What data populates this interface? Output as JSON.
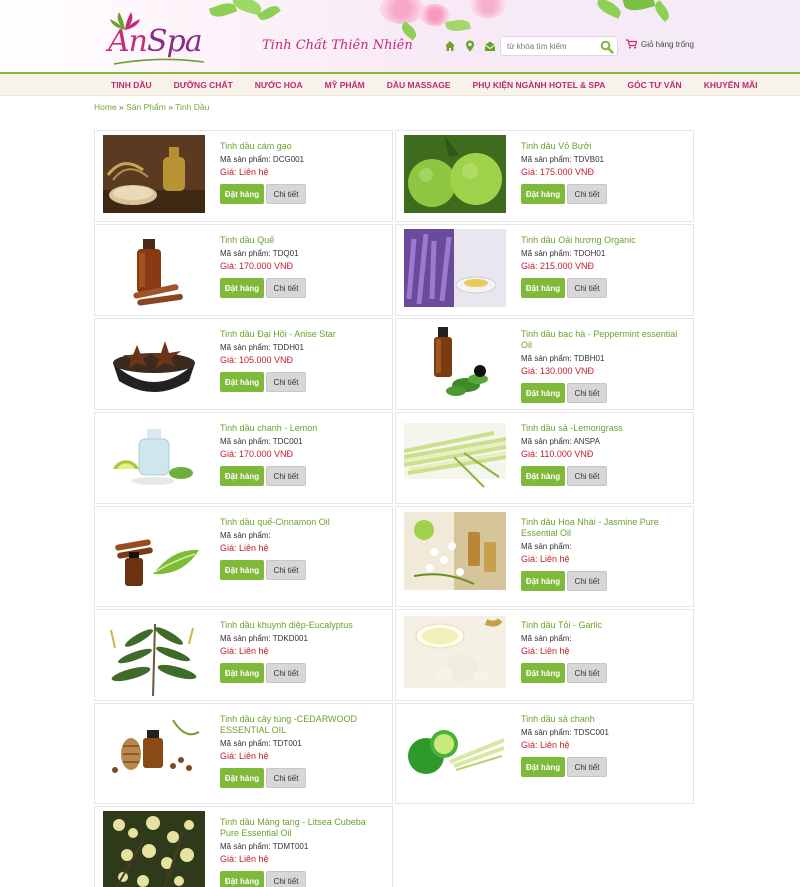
{
  "header": {
    "logo_text_a": "An",
    "logo_text_b": "Spa",
    "tagline": "Tinh Chất Thiên Nhiên",
    "search_placeholder": "từ khóa tìm kiếm",
    "cart_label": "Giỏ hàng trống"
  },
  "nav": [
    "TINH DẦU",
    "DƯỠNG CHẤT",
    "NƯỚC HOA",
    "MỸ PHẨM",
    "DẦU MASSAGE",
    "PHỤ KIỆN NGÀNH HOTEL & SPA",
    "GÓC TƯ VẤN",
    "KHUYẾN MÃI"
  ],
  "breadcrumb": {
    "home": "Home",
    "sep": " » ",
    "products": "Sản Phẩm",
    "current": "Tinh Dầu"
  },
  "buttons": {
    "order": "Đặt hàng",
    "detail": "Chi tiết"
  },
  "products": [
    {
      "name": "Tinh dầu cám gạo",
      "sku": "Mã sản phẩm: DCG001",
      "price": "Giá: Liên hệ",
      "image": "rice-bran-oil"
    },
    {
      "name": "Tinh dầu Vỏ Bưởi",
      "sku": "Mã sản phẩm: TDVB01",
      "price": "Giá: 175.000 VNĐ",
      "image": "pomelo"
    },
    {
      "name": "Tinh dầu Quế",
      "sku": "Mã sản phẩm: TDQ01",
      "price": "Giá: 170.000 VNĐ",
      "image": "cinnamon-bottle"
    },
    {
      "name": "Tinh dầu Oải hương Organic",
      "sku": "Mã sản phẩm: TDOH01",
      "price": "Giá: 215.000 VNĐ",
      "image": "lavender"
    },
    {
      "name": "Tinh dầu Đại Hồi - Anise Star",
      "sku": "Mã sản phẩm: TDDH01",
      "price": "Giá: 105.000 VNĐ",
      "image": "star-anise"
    },
    {
      "name": "Tinh dầu bạc hà - Peppermint essential Oil",
      "sku": "Mã sản phẩm: TDBH01",
      "price": "Giá: 130.000 VNĐ",
      "image": "peppermint"
    },
    {
      "name": "Tinh dầu chanh - Lemon",
      "sku": "Mã sản phẩm: TDC001",
      "price": "Giá: 170.000 VNĐ",
      "image": "lemon"
    },
    {
      "name": "Tinh dầu sả -Lemongrass",
      "sku": "Mã sản phẩm: ANSPA",
      "price": "Giá: 110.000 VNĐ",
      "image": "lemongrass"
    },
    {
      "name": "Tinh dầu quế-Cinnamon Oil",
      "sku": "Mã sản phẩm:",
      "price": "Giá: Liên hệ",
      "image": "cinnamon-oil"
    },
    {
      "name": "Tinh dầu Hoa Nhài - Jasmine Pure Essential Oil",
      "sku": "Mã sản phẩm:",
      "price": "Giá: Liên hệ",
      "image": "jasmine"
    },
    {
      "name": "Tinh dầu khuynh diệp-Eucalyptus",
      "sku": "Mã sản phẩm: TDKD001",
      "price": "Giá: Liên hệ",
      "image": "eucalyptus"
    },
    {
      "name": "Tinh dầu Tỏi - Garlic",
      "sku": "Mã sản phẩm:",
      "price": "Giá: Liên hệ",
      "image": "garlic"
    },
    {
      "name": "Tinh dầu cây tùng -CEDARWOOD ESSENTIAL OIL",
      "sku": "Mã sản phẩm: TDT001",
      "price": "Giá: Liên hệ",
      "image": "cedarwood"
    },
    {
      "name": "Tinh dầu sả chanh",
      "sku": "Mã sản phẩm: TDSC001",
      "price": "Giá: Liên hệ",
      "image": "lime-lemongrass"
    },
    {
      "name": "Tinh dầu Màng tang - Litsea Cubeba Pure Essential Oil",
      "sku": "Mã sản phẩm: TDMT001",
      "price": "Giá: Liên hệ",
      "image": "litsea"
    }
  ]
}
